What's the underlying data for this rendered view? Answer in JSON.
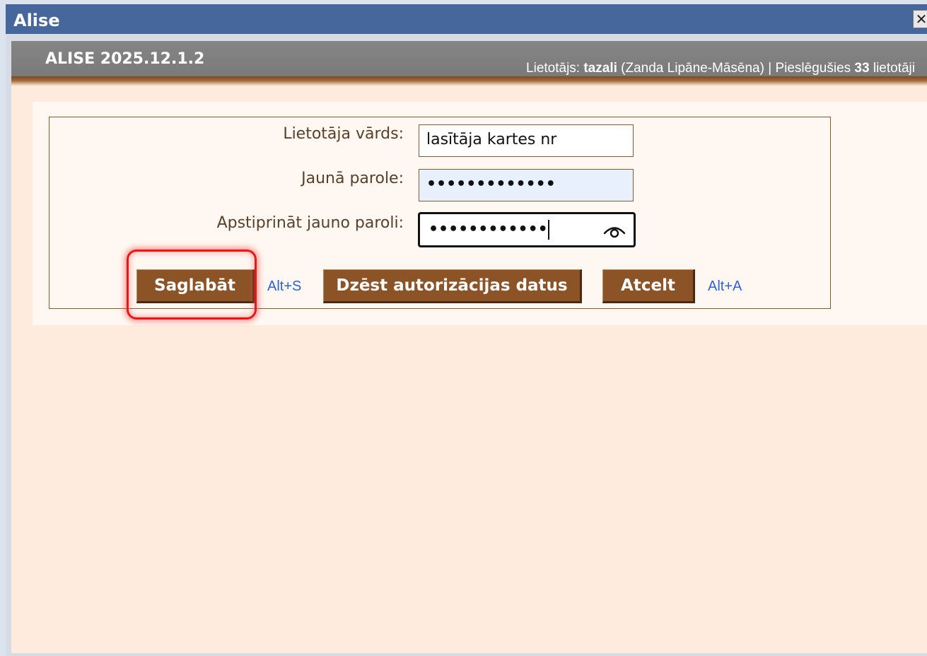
{
  "window": {
    "title": "Alise",
    "close_glyph": "✕"
  },
  "header": {
    "app_version": "ALISE 2025.12.1.2",
    "user_prefix": "Lietotājs:",
    "username": "tazali",
    "full_name": "(Zanda Lipāne-Māsēna)",
    "separator": "|",
    "connected_prefix": "Pieslēgušies",
    "connected_count": "33",
    "connected_suffix": "lietotāji"
  },
  "form": {
    "username_label": "Lietotāja vārds:",
    "username_value": "lasītāja kartes nr",
    "new_password_label": "Jaunā parole:",
    "new_password_value": "•••••••••••••",
    "confirm_password_label": "Apstiprināt jauno paroli:",
    "confirm_password_value": "••••••••••••",
    "show_password_icon": "eye-icon"
  },
  "buttons": {
    "save_label": "Saglabāt",
    "save_shortcut": "Alt+S",
    "delete_label": "Dzēst autorizācijas datus",
    "cancel_label": "Atcelt",
    "cancel_shortcut": "Alt+A"
  },
  "colors": {
    "titlebar": "#46679b",
    "button_brown": "#8c5327",
    "shortcut_blue": "#2d62d8",
    "highlight_red": "#e81818",
    "page_bg": "#ffebdd"
  }
}
